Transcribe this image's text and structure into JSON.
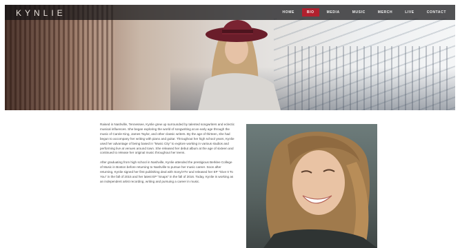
{
  "header": {
    "logo": "KYNLIE",
    "nav": [
      {
        "label": "HOME",
        "active": false
      },
      {
        "label": "BIO",
        "active": true
      },
      {
        "label": "MEDIA",
        "active": false
      },
      {
        "label": "MUSIC",
        "active": false
      },
      {
        "label": "MERCH",
        "active": false
      },
      {
        "label": "LIVE",
        "active": false
      },
      {
        "label": "CONTACT",
        "active": false
      }
    ],
    "active_color": "#b1202e"
  },
  "bio": {
    "paragraphs": [
      "Raised in Nashville, Tennessee, Kynlie grew up surrounded by talented songwriters and eclectic musical influences. She began exploring the world of songwriting at an early age through the music of Carole King, James Taylor, and other classic writers. By the age of thirteen, she had begun to accompany her writing with piano and guitar. Throughout her high school years, Kynlie used her advantage of being based in \"Music City\" to explore working in various studios and performing live at venues around town. She released her debut album at the age of sixteen and continued to release her original music throughout her teens.",
      "After graduating from high school in Nashville, Kynlie attended the prestigious Berklee College of Music in Boston before returning to Nashville to pursue her music career. Soon after returning, Kynlie signed her first publishing deal with Sony/ATV and released her EP \"Give It To You\" in the fall of 2015 and her latest EP \"Snaps\" in the fall of 2016. Today, Kynlie is working as an independent artist recording, writing and pursuing a career in music."
    ]
  }
}
